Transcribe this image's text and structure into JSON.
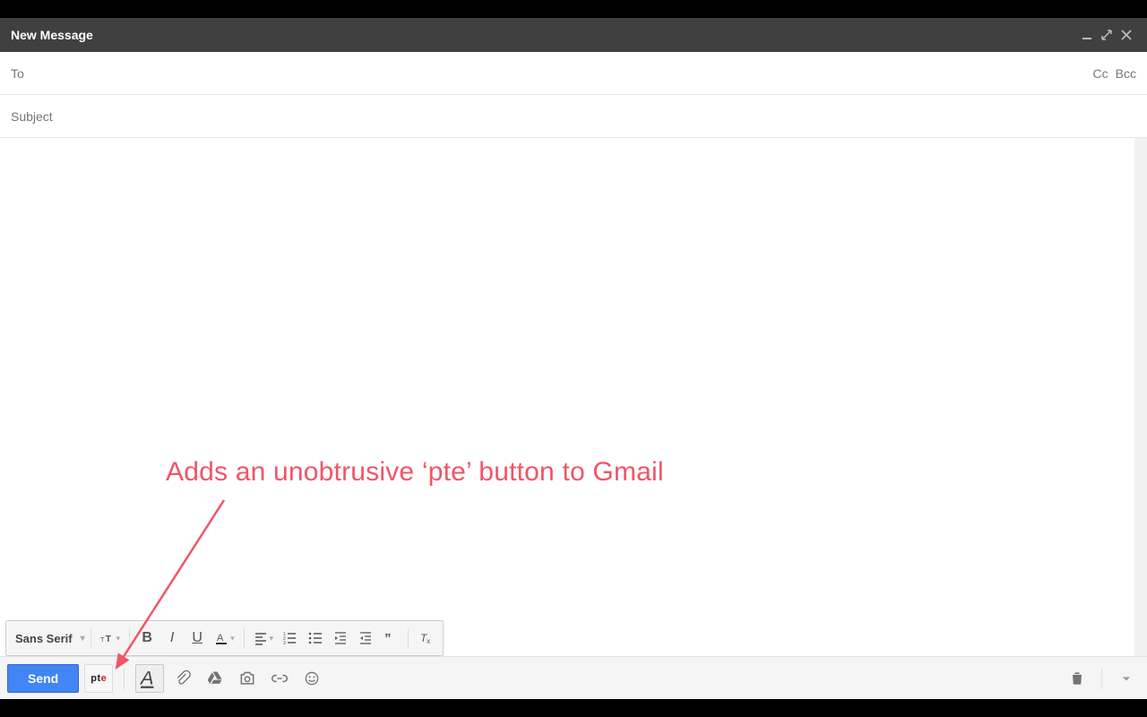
{
  "header": {
    "title": "New Message"
  },
  "recipients": {
    "to_label": "To",
    "cc_label": "Cc",
    "bcc_label": "Bcc"
  },
  "subject": {
    "placeholder": "Subject"
  },
  "format_toolbar": {
    "font_label": "Sans Serif"
  },
  "actions": {
    "send_label": "Send",
    "pte_label_p": "p",
    "pte_label_t": "t",
    "pte_label_e": "e"
  },
  "annotation": {
    "text": "Adds an unobtrusive ‘pte’ button to Gmail"
  }
}
